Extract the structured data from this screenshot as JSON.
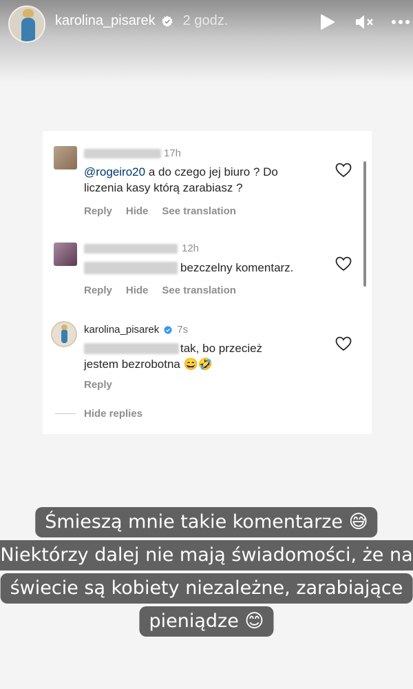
{
  "story": {
    "username": "karolina_pisarek",
    "time": "2 godz."
  },
  "comments": [
    {
      "time": "17h",
      "mention": "@rogeiro20",
      "text_line1": " a do czego jej biuro ? Do",
      "text_line2": "liczenia kasy którą zarabiasz ?",
      "actions": [
        "Reply",
        "Hide",
        "See translation"
      ]
    },
    {
      "time": "12h",
      "text": "bezczelny komentarz.",
      "actions": [
        "Reply",
        "Hide",
        "See translation"
      ]
    },
    {
      "username": "karolina_pisarek",
      "time": "7s",
      "text_line1": "tak, bo przecież",
      "text_line2": "jestem bezrobotna 😄🤣",
      "actions": [
        "Reply"
      ]
    }
  ],
  "hide_replies": "Hide replies",
  "caption": [
    "Śmieszą mnie takie komentarze 😅",
    "Niektórzy dalej nie mają świadomości, że na",
    "świecie są kobiety niezależne, zarabiające",
    "pieniądze 😊"
  ],
  "colors": {
    "caption_bg": "#616161",
    "mention": "#00376b",
    "verified": "#3897f0"
  },
  "icons": [
    "play-icon",
    "mute-icon",
    "more-icon",
    "heart-icon",
    "verified-badge-icon"
  ]
}
